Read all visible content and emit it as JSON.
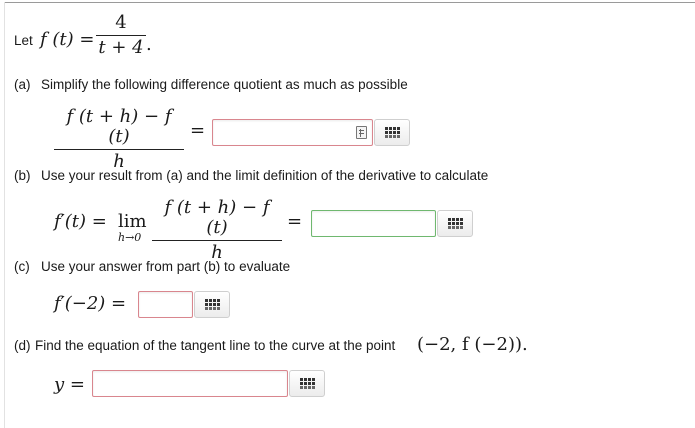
{
  "intro": {
    "prefix": "Let ",
    "lhs": "f (t) =",
    "numerator": "4",
    "denominator": "t + 4",
    "period": "."
  },
  "part_a": {
    "label": "(a)",
    "text": "Simplify the following difference quotient as much as possible",
    "numerator": "f (t + h) − f (t)",
    "denominator": "h",
    "equals": "=",
    "answer_value": ""
  },
  "part_b": {
    "label": "(b)",
    "text": "Use your result from (a) and the limit definition of the derivative to calculate",
    "lhs": "f′(t) =",
    "lim": "lim",
    "lim_sub": "h→0",
    "numerator": "f (t + h) − f (t)",
    "denominator": "h",
    "equals": "=",
    "answer_value": ""
  },
  "part_c": {
    "label": "(c)",
    "text": "Use your answer from part (b) to evaluate",
    "lhs": "f′(−2) =",
    "answer_value": ""
  },
  "part_d": {
    "label": "(d)",
    "text": "Find the equation of the tangent line to the curve at the point",
    "point": "(−2, f (−2)).",
    "lhs": "y =",
    "answer_value": ""
  },
  "icons": {
    "palette": "grid-icon",
    "preview": "preview-icon"
  },
  "colors": {
    "input_border_default": "#d9868e",
    "input_border_ok": "#6fb86f"
  }
}
